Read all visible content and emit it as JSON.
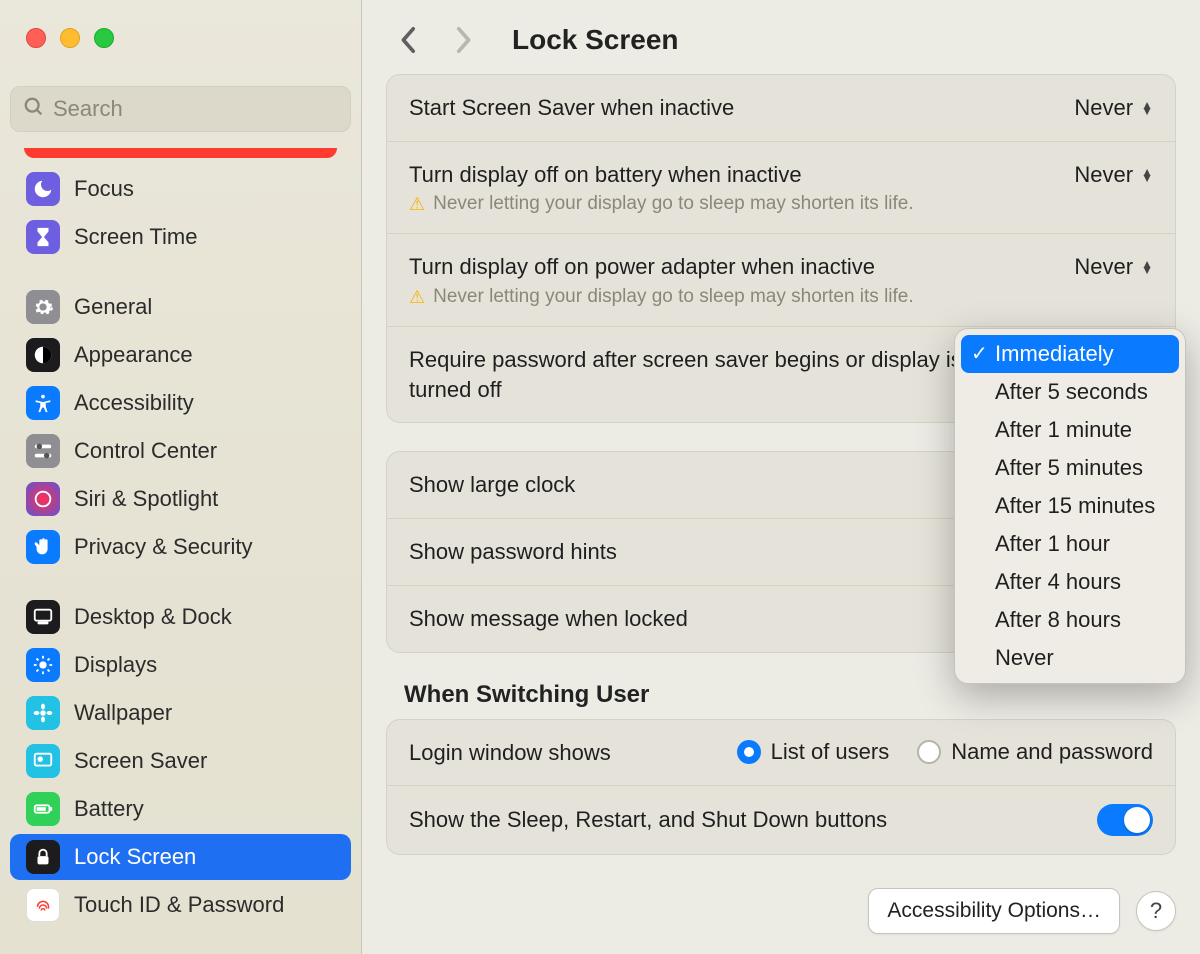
{
  "search": {
    "placeholder": "Search"
  },
  "header": {
    "title": "Lock Screen"
  },
  "sidebar": {
    "focus": "Focus",
    "screen_time": "Screen Time",
    "general": "General",
    "appearance": "Appearance",
    "accessibility": "Accessibility",
    "control_center": "Control Center",
    "siri": "Siri & Spotlight",
    "privacy": "Privacy & Security",
    "desktop_dock": "Desktop & Dock",
    "displays": "Displays",
    "wallpaper": "Wallpaper",
    "screen_saver": "Screen Saver",
    "battery": "Battery",
    "lock_screen": "Lock Screen",
    "touch_id": "Touch ID & Password"
  },
  "rows": {
    "screensaver": {
      "label": "Start Screen Saver when inactive",
      "value": "Never"
    },
    "battery_off": {
      "label": "Turn display off on battery when inactive",
      "value": "Never",
      "warn": "Never letting your display go to sleep may shorten its life."
    },
    "adapter_off": {
      "label": "Turn display off on power adapter when inactive",
      "value": "Never",
      "warn": "Never letting your display go to sleep may shorten its life."
    },
    "require_pw": {
      "label": "Require password after screen saver begins or display is turned off"
    },
    "large_clock": {
      "label": "Show large clock"
    },
    "pw_hints": {
      "label": "Show password hints"
    },
    "msg_locked": {
      "label": "Show message when locked"
    }
  },
  "switching_user": {
    "heading": "When Switching User",
    "login_shows": "Login window shows",
    "list_users": "List of users",
    "name_pw": "Name and password",
    "sleep_buttons": "Show the Sleep, Restart, and Shut Down buttons"
  },
  "menu": {
    "items": [
      "Immediately",
      "After 5 seconds",
      "After 1 minute",
      "After 5 minutes",
      "After 15 minutes",
      "After 1 hour",
      "After 4 hours",
      "After 8 hours",
      "Never"
    ]
  },
  "footer": {
    "accessibility_options": "Accessibility Options…",
    "help": "?"
  }
}
